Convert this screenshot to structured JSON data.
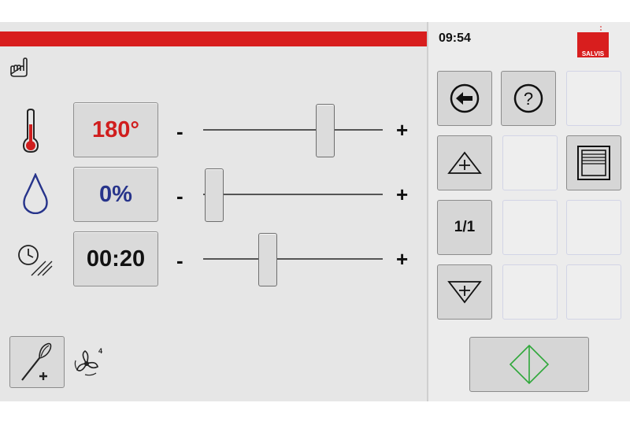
{
  "status": {
    "time": "09:54",
    "brand": "SALVIS",
    "brand_color": "#d81e1e"
  },
  "params": {
    "temperature": {
      "icon": "thermometer-icon",
      "value": "180°",
      "color": "#d01e1e",
      "minus": "-",
      "plus": "+",
      "level": 0.65
    },
    "humidity": {
      "icon": "water-drop-icon",
      "value": "0%",
      "color": "#27348b",
      "minus": "-",
      "plus": "+",
      "level": 0.0
    },
    "time": {
      "icon": "timer-icon",
      "value": "00:20",
      "color": "#111111",
      "minus": "-",
      "plus": "+",
      "level": 0.32
    }
  },
  "grid": {
    "row1": [
      "back-arrow-icon",
      "help-icon",
      ""
    ],
    "row2": [
      "add-step-up-icon",
      "",
      "door-icon"
    ],
    "row3": {
      "label": "1/1"
    },
    "row4": [
      "add-step-down-icon",
      "",
      ""
    ]
  },
  "bottom": {
    "whisk_button": "whisk-add-icon",
    "fan_icon": "fan-icon",
    "fan_level": "4"
  },
  "start_button": {
    "icon": "start-diamond-icon",
    "color": "#2fa83a"
  }
}
